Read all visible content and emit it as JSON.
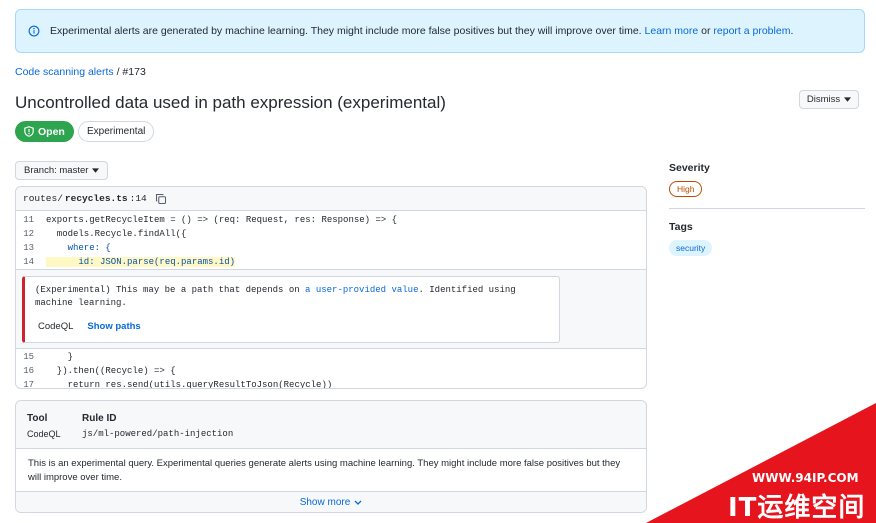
{
  "banner": {
    "text": "Experimental alerts are generated by machine learning. They might include more false positives but they will improve over time.",
    "learn_more": "Learn more",
    "or": "or",
    "report": "report a problem",
    "period": "."
  },
  "breadcrumb": {
    "link": "Code scanning alerts",
    "sep": "/",
    "current": "#173"
  },
  "title": "Uncontrolled data used in path expression (experimental)",
  "dismiss_label": "Dismiss",
  "state": {
    "open": "Open",
    "experimental": "Experimental"
  },
  "branch": {
    "label": "Branch: master"
  },
  "code": {
    "path_prefix": "routes/",
    "file": "recycles.ts",
    "line_suffix": ":14",
    "lines_before": [
      {
        "n": "11",
        "code": "exports.getRecycleItem = () => (req: Request, res: Response) => {"
      },
      {
        "n": "12",
        "code": "  models.Recycle.findAll({"
      },
      {
        "n": "13",
        "code": "    where: {"
      },
      {
        "n": "14",
        "code": "      id: JSON.parse(req.params.id)"
      }
    ],
    "lines_after": [
      {
        "n": "15",
        "code": "    }"
      },
      {
        "n": "16",
        "code": "  }).then((Recycle) => {"
      },
      {
        "n": "17",
        "code": "    return res.send(utils.queryResultToJson(Recycle))"
      }
    ]
  },
  "alert": {
    "text_before": "(Experimental) This may be a path that depends on ",
    "link": "a user-provided value",
    "text_after": ". Identified using machine learning.",
    "tool": "CodeQL",
    "show_paths": "Show paths"
  },
  "sidebar": {
    "severity_title": "Severity",
    "severity": "High",
    "tags_title": "Tags",
    "tag": "security"
  },
  "rule": {
    "tool_label": "Tool",
    "tool_value": "CodeQL",
    "rule_label": "Rule ID",
    "rule_value": "js/ml-powered/path-injection",
    "description": "This is an experimental query. Experimental queries generate alerts using machine learning. They might include more false positives but they will improve over time.",
    "show_more": "Show more"
  },
  "watermark": {
    "url": "WWW.94IP.COM",
    "logo": "IT运维空间"
  },
  "colors": {
    "accent": "#0969da",
    "open_green": "#2da44e",
    "severity": "#bc4c00",
    "alert_red": "#cf222e"
  }
}
